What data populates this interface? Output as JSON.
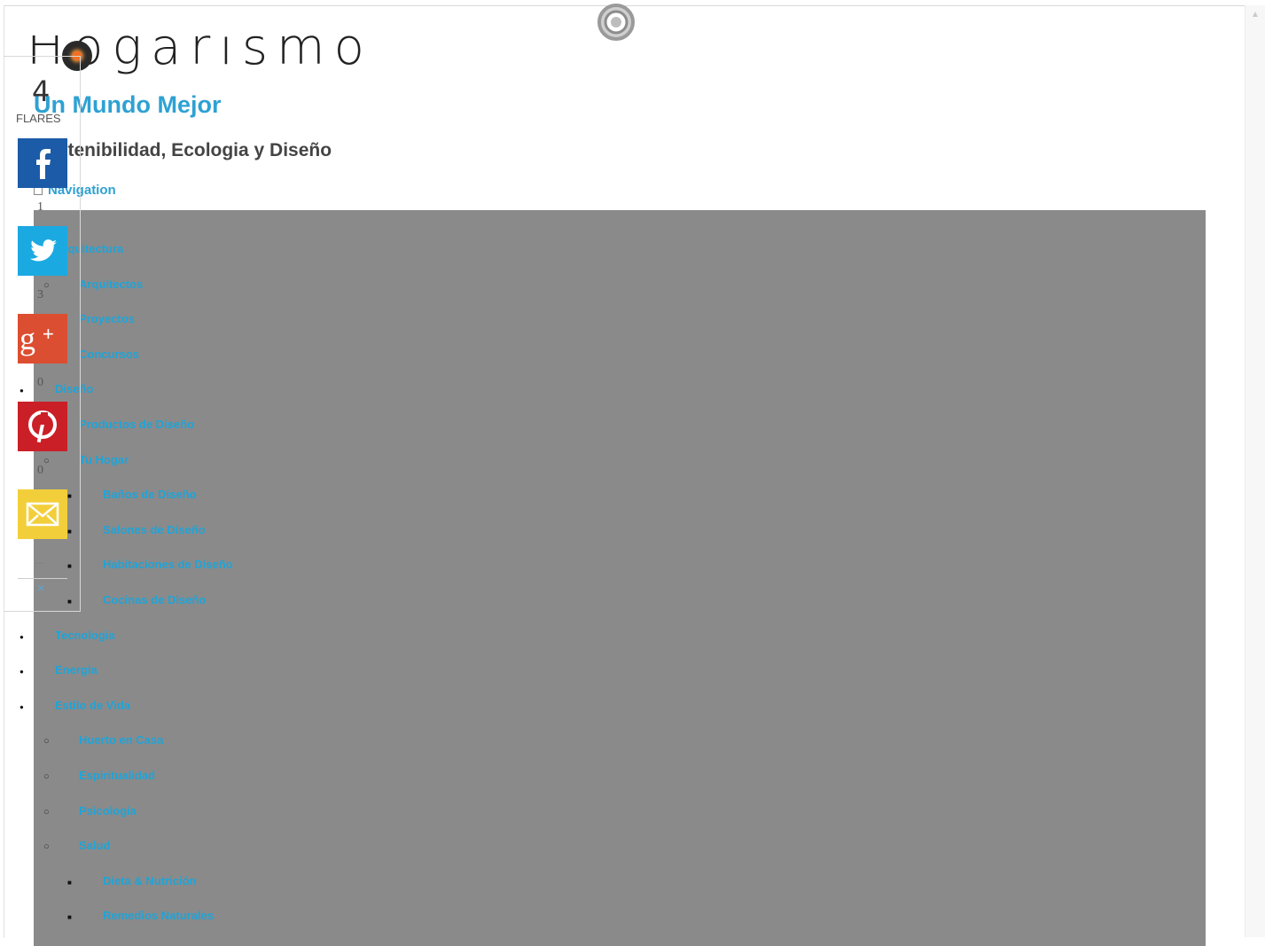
{
  "site": {
    "logo_text": "Hogarismo",
    "tagline": "Un Mundo Mejor",
    "subtitle": "Sostenibilidad, Ecologia y Diseño",
    "nav_toggle": "Navigation"
  },
  "share": {
    "flares_count": "4",
    "flares_label": "FLARES",
    "facebook_count": "1",
    "twitter_count": "3",
    "googleplus_count": "0",
    "pinterest_count": "0",
    "more_label": "...",
    "close_label": "×",
    "colors": {
      "facebook": "#1b5ba8",
      "twitter": "#1ba9e1",
      "googleplus": "#dc4e31",
      "pinterest": "#cb1f27",
      "email": "#f2cf3a"
    }
  },
  "menu": {
    "items": [
      {
        "label": "Arquitectura",
        "level": 1
      },
      {
        "label": "Arquitectos",
        "level": 2
      },
      {
        "label": "Proyectos",
        "level": 2
      },
      {
        "label": "Concursos",
        "level": 2
      },
      {
        "label": "Diseño",
        "level": 1
      },
      {
        "label": "Productos de Diseño",
        "level": 2
      },
      {
        "label": "Tu Hogar",
        "level": 2
      },
      {
        "label": "Baños de Diseño",
        "level": 3
      },
      {
        "label": "Salones de Diseño",
        "level": 3
      },
      {
        "label": "Habitaciones de Diseño",
        "level": 3
      },
      {
        "label": "Cocinas de Diseño",
        "level": 3
      },
      {
        "label": "Tecnologia",
        "level": 1
      },
      {
        "label": "Energia",
        "level": 1
      },
      {
        "label": "Estilo de Vida",
        "level": 1
      },
      {
        "label": "Huerto en Casa",
        "level": 2
      },
      {
        "label": "Espiritualidad",
        "level": 2
      },
      {
        "label": "Psicologia",
        "level": 2
      },
      {
        "label": "Salud",
        "level": 2
      },
      {
        "label": "Dieta & Nutrición",
        "level": 3
      },
      {
        "label": "Remedios Naturales",
        "level": 3
      }
    ],
    "panel_color": "#8a8a8a",
    "link_color": "#1fa4d8"
  }
}
